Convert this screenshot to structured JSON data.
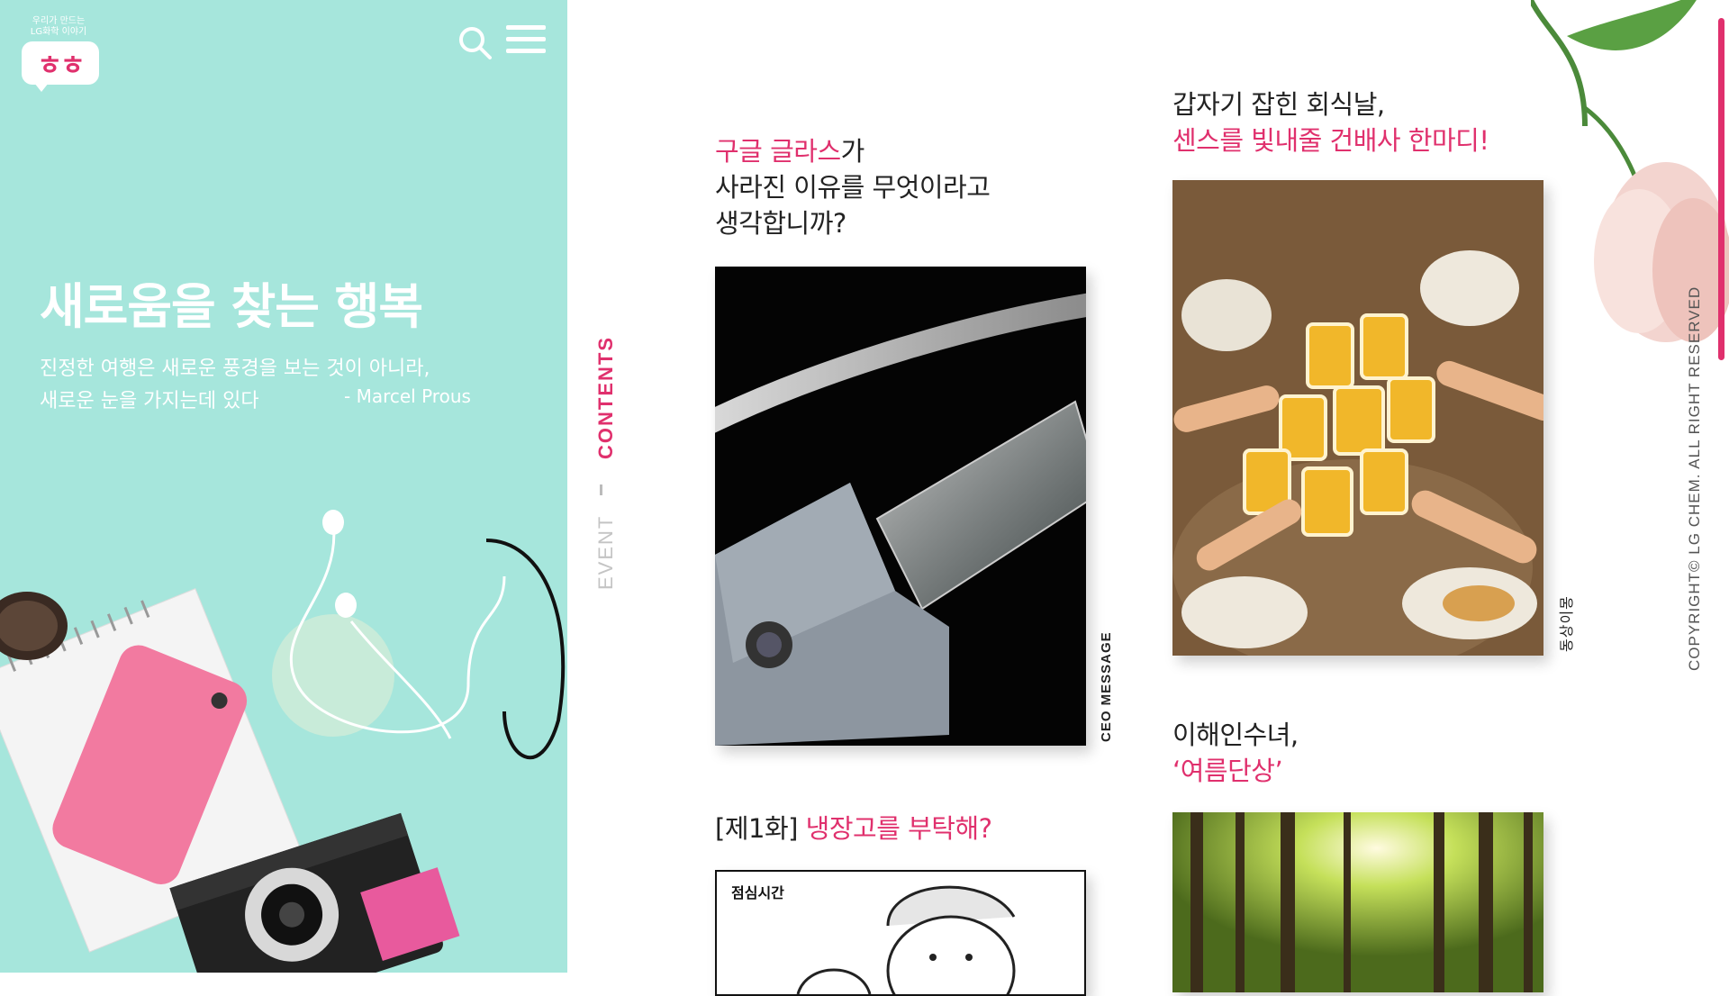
{
  "header": {
    "logo_tagline_line1": "우리가 만드는",
    "logo_tagline_line2": "LG화학 이야기",
    "logo_mark": "ㅎㅎ",
    "search_icon": "search-icon",
    "menu_icon": "hamburger-menu-icon"
  },
  "hero": {
    "title": "새로움을 찾는 행복",
    "quote_line1": "진정한 여행은 새로운 풍경을 보는 것이 아니라,",
    "quote_line2": "새로운 눈을 가지는데 있다",
    "author": "- Marcel Prous"
  },
  "nav": {
    "contents": "CONTENTS",
    "event": "EVENT"
  },
  "cards": [
    {
      "title_pink": "구글 글라스",
      "title_rest1": "가",
      "title_line2": "사라진 이유를 무엇이라고",
      "title_line3": "생각합니까?",
      "label": "CEO MESSAGE"
    },
    {
      "title_line1": "갑자기 잡힌 회식날,",
      "title_line2_pink": "센스를 빛내줄 건배사 한마디!",
      "label": "동상이몽"
    },
    {
      "title_bracket": "[제1화] ",
      "title_pink": "냉장고를 부탁해?",
      "comic_text": "점심시간"
    },
    {
      "title_line1": "이해인수녀,",
      "title_line2_pink": "‘여름단상’"
    }
  ],
  "footer": {
    "copyright": "COPYRIGHT© LG CHEM. ALL RIGHT RESERVED"
  },
  "colors": {
    "accent": "#e0306d",
    "teal": "#a6e6dc",
    "muted": "#c4c4c4"
  }
}
